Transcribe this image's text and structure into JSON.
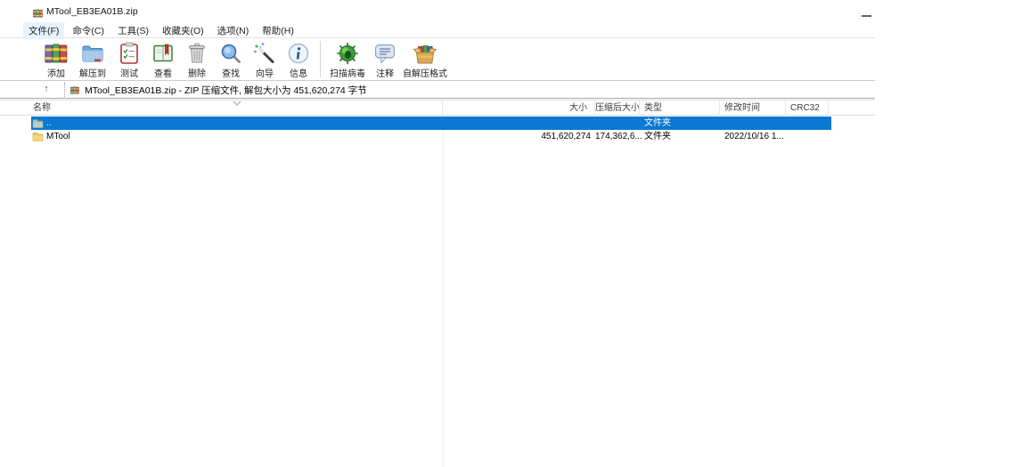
{
  "window": {
    "title": "MTool_EB3EA01B.zip",
    "minimize_glyph": ""
  },
  "menu": {
    "items": [
      {
        "label": "文件(F)"
      },
      {
        "label": "命令(C)"
      },
      {
        "label": "工具(S)"
      },
      {
        "label": "收藏夹(O)"
      },
      {
        "label": "选项(N)"
      },
      {
        "label": "帮助(H)"
      }
    ]
  },
  "toolbar": {
    "buttons": [
      {
        "label": "添加",
        "icon": "winrar-archive-icon"
      },
      {
        "label": "解压到",
        "icon": "extract-folder-icon"
      },
      {
        "label": "测试",
        "icon": "test-clipboard-icon"
      },
      {
        "label": "查看",
        "icon": "view-book-icon"
      },
      {
        "label": "删除",
        "icon": "delete-trash-icon"
      },
      {
        "label": "查找",
        "icon": "find-magnifier-icon"
      },
      {
        "label": "向导",
        "icon": "wizard-wand-icon"
      },
      {
        "label": "信息",
        "icon": "info-icon"
      },
      {
        "label": "扫描病毒",
        "icon": "virus-scan-icon"
      },
      {
        "label": "注释",
        "icon": "comment-bubble-icon"
      },
      {
        "label": "自解压格式",
        "icon": "sfx-box-icon"
      }
    ]
  },
  "addressbar": {
    "up_arrow": "↑",
    "text": "MTool_EB3EA01B.zip - ZIP 压缩文件, 解包大小为 451,620,274 字节"
  },
  "list": {
    "columns": {
      "name": "名称",
      "size": "大小",
      "packed": "压缩后大小",
      "type": "类型",
      "modified": "修改时间",
      "crc": "CRC32"
    },
    "rows": [
      {
        "name": "..",
        "size": "",
        "packed": "",
        "type": "文件夹",
        "modified": "",
        "crc": "",
        "icon": "parent-folder-icon",
        "selected": true
      },
      {
        "name": "MTool",
        "size": "451,620,274",
        "packed": "174,362,6...",
        "type": "文件夹",
        "modified": "2022/10/16 1...",
        "crc": "",
        "icon": "folder-icon",
        "selected": false
      }
    ]
  },
  "colors": {
    "selection_blue": "#0c78d2",
    "folder_yellow": "#f2c65e",
    "parent_folder_gray_green": "#a9bfb0",
    "menu_highlight": "#e7f3fc"
  }
}
